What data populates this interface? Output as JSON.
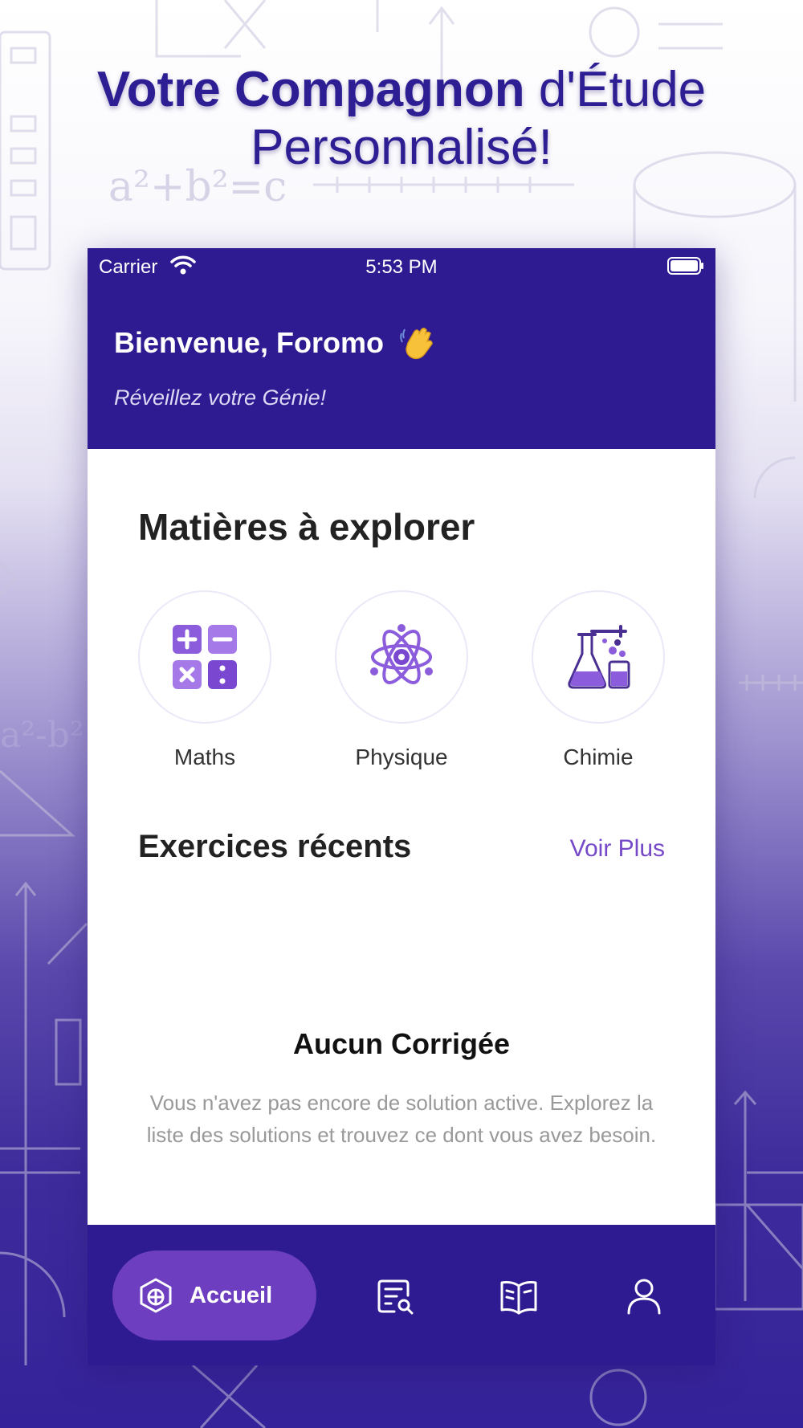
{
  "promo": {
    "title_bold": "Votre Compagnon",
    "title_rest": "d'Étude",
    "title_line2": "Personnalisé!"
  },
  "status_bar": {
    "carrier": "Carrier",
    "time": "5:53 PM"
  },
  "header": {
    "welcome": "Bienvenue, Foromo",
    "tagline": "Réveillez votre Génie!"
  },
  "subjects_section": {
    "title": "Matières à explorer",
    "items": [
      {
        "label": "Maths",
        "icon": "calculator-icon"
      },
      {
        "label": "Physique",
        "icon": "atom-icon"
      },
      {
        "label": "Chimie",
        "icon": "lab-flask-icon"
      }
    ]
  },
  "recent_section": {
    "title": "Exercices récents",
    "see_more": "Voir Plus"
  },
  "empty_state": {
    "title": "Aucun Corrigée",
    "description": "Vous n'avez pas encore de solution active. Explorez la liste des solutions et trouvez ce dont vous avez besoin."
  },
  "tabbar": {
    "active_label": "Accueil",
    "tabs": [
      "home-icon",
      "search-document-icon",
      "book-icon",
      "profile-icon"
    ]
  },
  "colors": {
    "primary": "#2e1a91",
    "accent": "#6d3fc0",
    "link": "#7649c8",
    "icon_purple": "#8b5cdc"
  }
}
